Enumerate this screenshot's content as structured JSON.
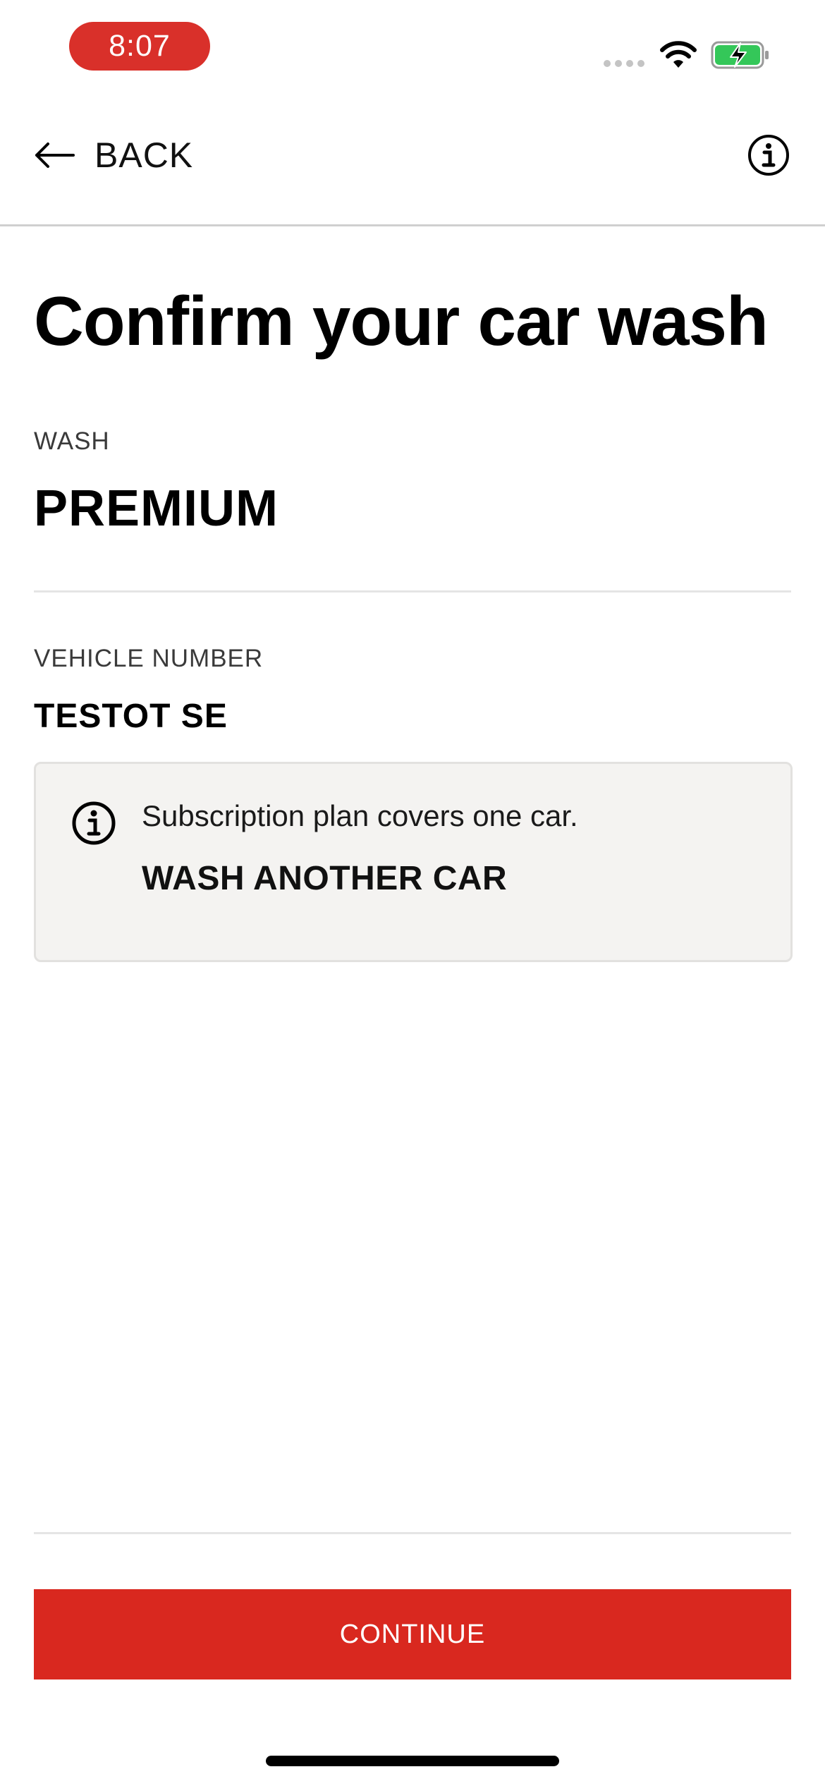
{
  "status_bar": {
    "time": "8:07",
    "time_pill_color": "#d9302a",
    "icons": [
      "signal-icon",
      "wifi-icon",
      "battery-charging-icon"
    ]
  },
  "nav": {
    "back_label": "BACK",
    "back_icon": "arrow-left-icon",
    "info_icon": "info-icon"
  },
  "page": {
    "title": "Confirm your car wash"
  },
  "wash": {
    "label": "WASH",
    "value": "PREMIUM"
  },
  "vehicle": {
    "label": "VEHICLE NUMBER",
    "value": "TESTOT SE"
  },
  "notice": {
    "icon": "info-icon",
    "text": "Subscription plan covers one car.",
    "link_label": "WASH ANOTHER CAR"
  },
  "actions": {
    "continue_label": "CONTINUE",
    "accent_color": "#d9281f"
  }
}
